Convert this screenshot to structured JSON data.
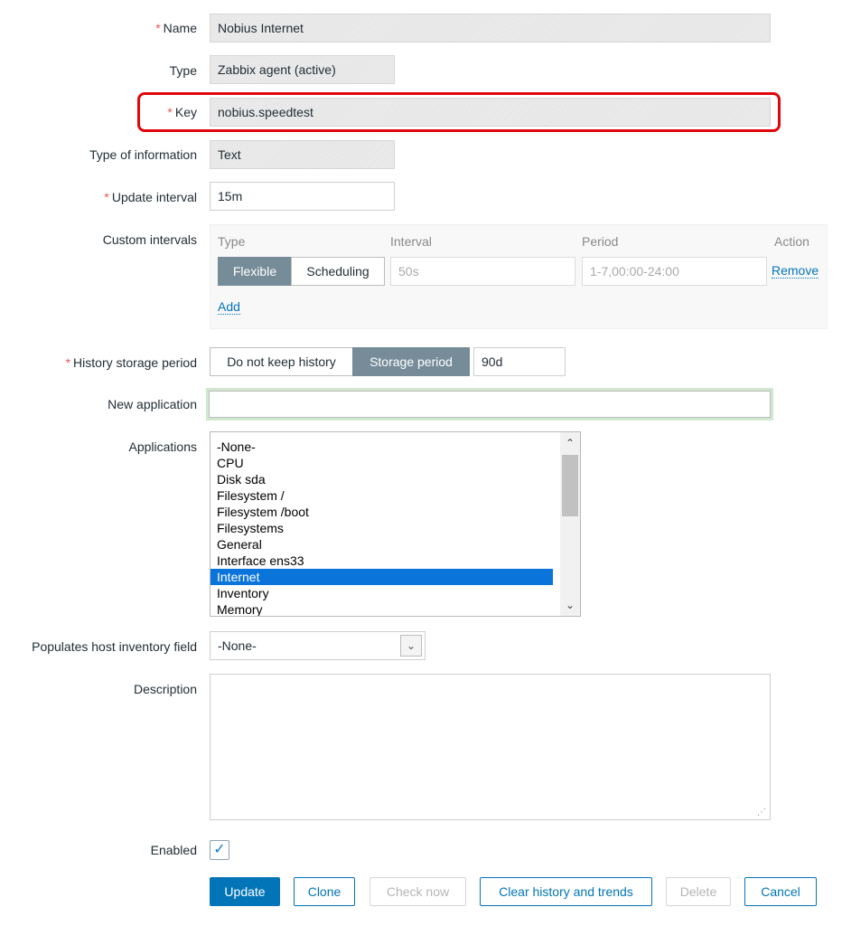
{
  "fields": {
    "name": {
      "label": "Name",
      "value": "Nobius Internet",
      "required": true
    },
    "type": {
      "label": "Type",
      "value": "Zabbix agent (active)"
    },
    "key": {
      "label": "Key",
      "value": "nobius.speedtest",
      "required": true
    },
    "type_of_information": {
      "label": "Type of information",
      "value": "Text"
    },
    "update_interval": {
      "label": "Update interval",
      "value": "15m",
      "required": true
    },
    "custom_intervals": {
      "label": "Custom intervals",
      "headers": {
        "type": "Type",
        "interval": "Interval",
        "period": "Period",
        "action": "Action"
      },
      "row": {
        "type_options": [
          "Flexible",
          "Scheduling"
        ],
        "selected_type": "Flexible",
        "interval_placeholder": "50s",
        "period_placeholder": "1-7,00:00-24:00",
        "remove": "Remove"
      },
      "add": "Add"
    },
    "history_storage": {
      "label": "History storage period",
      "required": true,
      "options": [
        "Do not keep history",
        "Storage period"
      ],
      "selected": "Storage period",
      "value": "90d"
    },
    "new_application": {
      "label": "New application",
      "value": ""
    },
    "applications": {
      "label": "Applications",
      "items": [
        "-None-",
        "CPU",
        "Disk sda",
        "Filesystem /",
        "Filesystem /boot",
        "Filesystems",
        "General",
        "Interface ens33",
        "Internet",
        "Inventory",
        "Memory"
      ],
      "selected": "Internet"
    },
    "inventory_field": {
      "label": "Populates host inventory field",
      "value": "-None-"
    },
    "description": {
      "label": "Description",
      "value": ""
    },
    "enabled": {
      "label": "Enabled",
      "checked": true
    }
  },
  "buttons": {
    "update": "Update",
    "clone": "Clone",
    "check_now": "Check now",
    "clear": "Clear history and trends",
    "delete": "Delete",
    "cancel": "Cancel"
  },
  "colors": {
    "accent": "#0275b8",
    "highlight_box": "#e0060c",
    "selected_item": "#0a74da",
    "toggle_on": "#768d99",
    "required_asterisk": "#e45959"
  }
}
